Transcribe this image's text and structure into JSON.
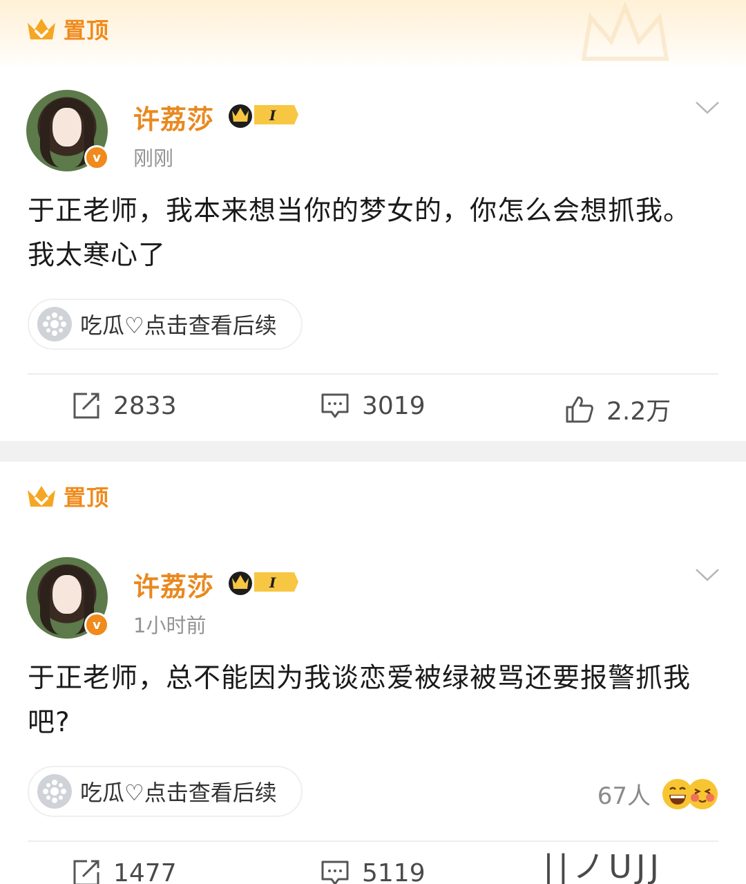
{
  "posts": [
    {
      "pinned_label": "置顶",
      "username": "许荔莎",
      "vip_level": "I",
      "timestamp": "刚刚",
      "content": "于正老师，我本来想当你的梦女的，你怎么会想抓我。我太寒心了",
      "topic_chip": "吃瓜♡点击查看后续",
      "reposts": "2833",
      "comments": "3019",
      "likes": "2.2万"
    },
    {
      "pinned_label": "置顶",
      "username": "许荔莎",
      "vip_level": "I",
      "timestamp": "1小时前",
      "content": "于正老师，总不能因为我谈恋爱被绿被骂还要报警抓我吧?",
      "topic_chip": "吃瓜♡点击查看后续",
      "reaction_count": "67人",
      "reposts": "1477",
      "comments": "5119",
      "watermark": "||ノUJJ"
    }
  ],
  "colors": {
    "brand_orange": "#f08a1c",
    "username": "#e8891f",
    "muted": "#939393"
  }
}
